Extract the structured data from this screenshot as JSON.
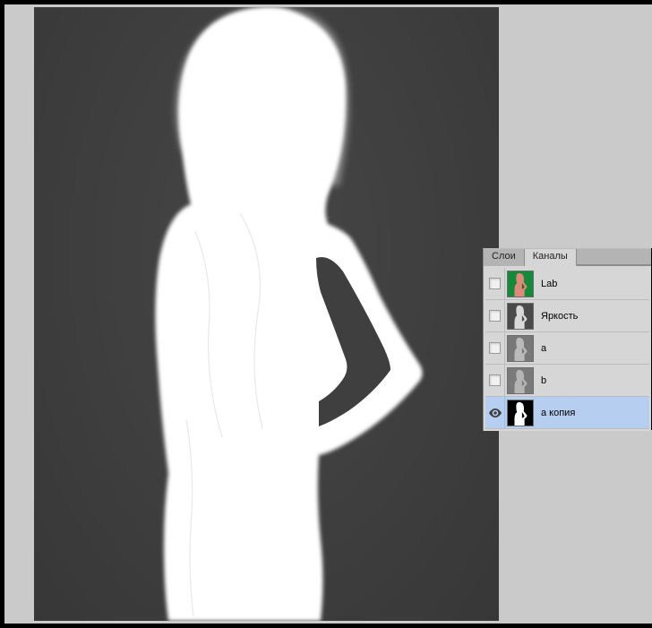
{
  "tabs": {
    "layers": "Слои",
    "channels": "Каналы"
  },
  "channels": [
    {
      "label": "Lab",
      "thumb_type": "lab",
      "visible": false,
      "selected": false
    },
    {
      "label": "Яркость",
      "thumb_type": "gray",
      "visible": false,
      "selected": false
    },
    {
      "label": "a",
      "thumb_type": "gray",
      "visible": false,
      "selected": false
    },
    {
      "label": "b",
      "thumb_type": "gray",
      "visible": false,
      "selected": false
    },
    {
      "label": "a копия",
      "thumb_type": "bw",
      "visible": true,
      "selected": true
    }
  ],
  "colors": {
    "panel_bg": "#d6d6d6",
    "selected_bg": "#b6cff0",
    "canvas_bg": "#cacaca",
    "image_bg": "#3f3f3f"
  }
}
